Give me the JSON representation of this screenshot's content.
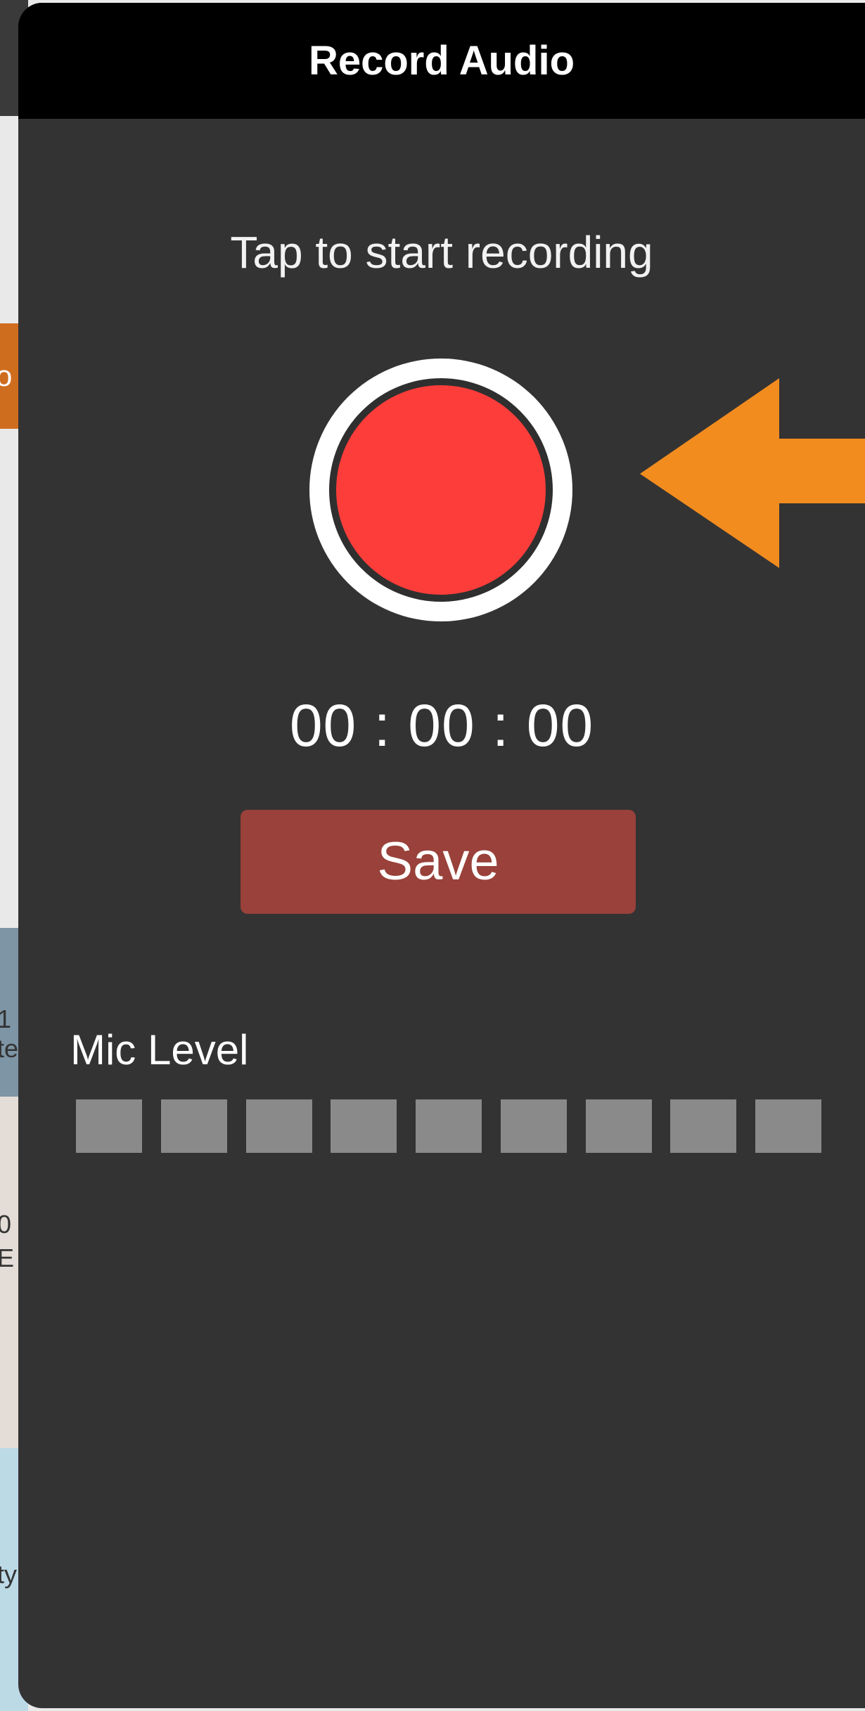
{
  "background": {
    "tab_fragment": "o",
    "map_fragments": [
      "1",
      "te",
      "0",
      "E",
      "ty"
    ]
  },
  "modal": {
    "title": "Record Audio",
    "prompt": "Tap to start recording",
    "timer": "00 : 00 : 00",
    "save_label": "Save",
    "mic_label": "Mic Level",
    "mic_segments": 9,
    "mic_level_filled": 0,
    "record_icon": "record-icon",
    "annotation_icon": "pointer-arrow-icon"
  },
  "colors": {
    "header": "#000000",
    "panel": "#333333",
    "record": "#fd3d3a",
    "save": "#99413a",
    "mic_segment_inactive": "#8a8a8a",
    "annotation_arrow": "#f28c1f"
  }
}
